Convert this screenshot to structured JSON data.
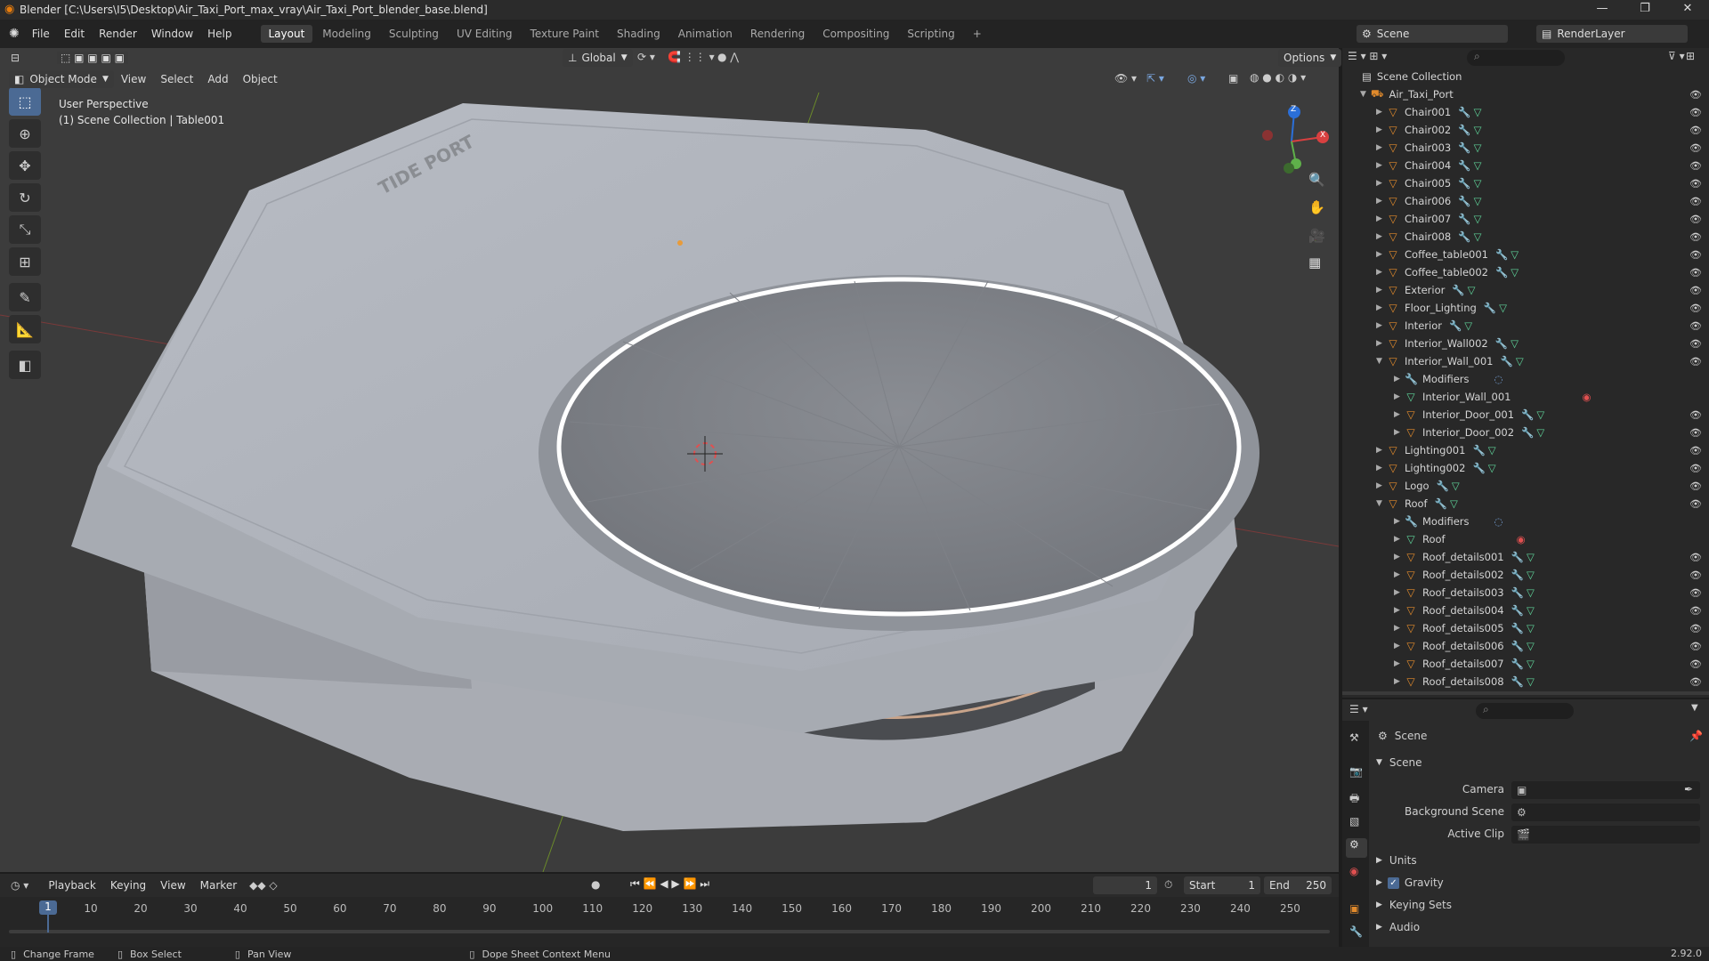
{
  "window": {
    "title": "Blender [C:\\Users\\I5\\Desktop\\Air_Taxi_Port_max_vray\\Air_Taxi_Port_blender_base.blend]",
    "minimize": "—",
    "maximize": "❐",
    "close": "✕"
  },
  "menu": [
    "File",
    "Edit",
    "Render",
    "Window",
    "Help"
  ],
  "workspaces": [
    "Layout",
    "Modeling",
    "Sculpting",
    "UV Editing",
    "Texture Paint",
    "Shading",
    "Animation",
    "Rendering",
    "Compositing",
    "Scripting",
    "+"
  ],
  "scene_name": "Scene",
  "render_layer": "RenderLayer",
  "header": {
    "mode": "Object Mode",
    "view": "View",
    "select": "Select",
    "add": "Add",
    "object": "Object",
    "orientation": "Global",
    "options": "Options"
  },
  "viewport": {
    "perspective": "User Perspective",
    "collection": "(1) Scene Collection | Table001",
    "building_text": "TIDE PORT",
    "gizmo": {
      "x": "X",
      "y": "Y",
      "z": "Z"
    }
  },
  "outliner": {
    "root": "Scene Collection",
    "collection": "Air_Taxi_Port",
    "items": [
      {
        "label": "Chair001",
        "level": 1,
        "type": "obj",
        "open": false
      },
      {
        "label": "Chair002",
        "level": 1,
        "type": "obj",
        "open": false
      },
      {
        "label": "Chair003",
        "level": 1,
        "type": "obj",
        "open": false
      },
      {
        "label": "Chair004",
        "level": 1,
        "type": "obj",
        "open": false
      },
      {
        "label": "Chair005",
        "level": 1,
        "type": "obj",
        "open": false
      },
      {
        "label": "Chair006",
        "level": 1,
        "type": "obj",
        "open": false
      },
      {
        "label": "Chair007",
        "level": 1,
        "type": "obj",
        "open": false
      },
      {
        "label": "Chair008",
        "level": 1,
        "type": "obj",
        "open": false
      },
      {
        "label": "Coffee_table001",
        "level": 1,
        "type": "obj",
        "open": false
      },
      {
        "label": "Coffee_table002",
        "level": 1,
        "type": "obj",
        "open": false
      },
      {
        "label": "Exterior",
        "level": 1,
        "type": "obj",
        "open": false
      },
      {
        "label": "Floor_Lighting",
        "level": 1,
        "type": "obj",
        "open": false
      },
      {
        "label": "Interior",
        "level": 1,
        "type": "obj",
        "open": false
      },
      {
        "label": "Interior_Wall002",
        "level": 1,
        "type": "obj",
        "open": false
      },
      {
        "label": "Interior_Wall_001",
        "level": 1,
        "type": "obj",
        "open": true
      },
      {
        "label": "Modifiers",
        "level": 2,
        "type": "mod",
        "open": false
      },
      {
        "label": "Interior_Wall_001",
        "level": 2,
        "type": "mesh",
        "open": false
      },
      {
        "label": "Interior_Door_001",
        "level": 2,
        "type": "obj",
        "open": false
      },
      {
        "label": "Interior_Door_002",
        "level": 2,
        "type": "obj",
        "open": false
      },
      {
        "label": "Lighting001",
        "level": 1,
        "type": "obj",
        "open": false
      },
      {
        "label": "Lighting002",
        "level": 1,
        "type": "obj",
        "open": false
      },
      {
        "label": "Logo",
        "level": 1,
        "type": "obj",
        "open": false
      },
      {
        "label": "Roof",
        "level": 1,
        "type": "obj",
        "open": true
      },
      {
        "label": "Modifiers",
        "level": 2,
        "type": "mod",
        "open": false
      },
      {
        "label": "Roof",
        "level": 2,
        "type": "mesh",
        "open": false
      },
      {
        "label": "Roof_details001",
        "level": 2,
        "type": "obj",
        "open": false
      },
      {
        "label": "Roof_details002",
        "level": 2,
        "type": "obj",
        "open": false
      },
      {
        "label": "Roof_details003",
        "level": 2,
        "type": "obj",
        "open": false
      },
      {
        "label": "Roof_details004",
        "level": 2,
        "type": "obj",
        "open": false
      },
      {
        "label": "Roof_details005",
        "level": 2,
        "type": "obj",
        "open": false
      },
      {
        "label": "Roof_details006",
        "level": 2,
        "type": "obj",
        "open": false
      },
      {
        "label": "Roof_details007",
        "level": 2,
        "type": "obj",
        "open": false
      },
      {
        "label": "Roof_details008",
        "level": 2,
        "type": "obj",
        "open": false
      }
    ]
  },
  "properties": {
    "title": "Scene",
    "panel": "Scene",
    "camera_label": "Camera",
    "bg_label": "Background Scene",
    "clip_label": "Active Clip",
    "units": "Units",
    "gravity": "Gravity",
    "gravity_checked": true,
    "keying": "Keying Sets",
    "audio": "Audio"
  },
  "timeline": {
    "playback": "Playback",
    "keying": "Keying",
    "view": "View",
    "marker": "Marker",
    "current": "1",
    "start_label": "Start",
    "start": "1",
    "end_label": "End",
    "end": "250",
    "ticks": [
      "1",
      "10",
      "20",
      "30",
      "40",
      "50",
      "60",
      "70",
      "80",
      "90",
      "100",
      "110",
      "120",
      "130",
      "140",
      "150",
      "160",
      "170",
      "180",
      "190",
      "200",
      "210",
      "220",
      "230",
      "240",
      "250"
    ]
  },
  "status": {
    "change_frame": "Change Frame",
    "box_select": "Box Select",
    "pan_view": "Pan View",
    "context": "Dope Sheet Context Menu",
    "version": "2.92.0"
  },
  "colors": {
    "accent": "#4b6a94",
    "object": "#e08a2c",
    "mesh": "#5fd49a"
  }
}
